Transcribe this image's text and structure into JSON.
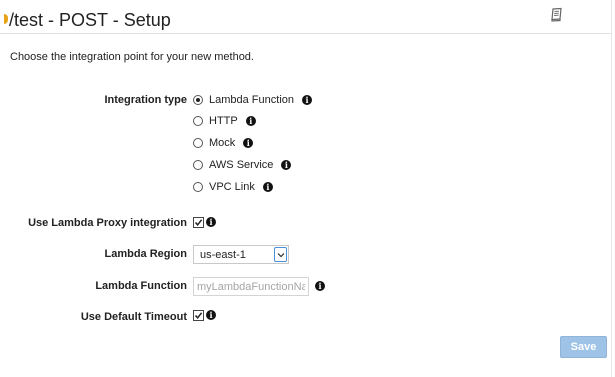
{
  "header": {
    "title": "/test - POST - Setup",
    "help_icon": "book-icon"
  },
  "intro": "Choose the integration point for your new method.",
  "integration_type": {
    "label": "Integration type",
    "selected": "Lambda Function",
    "options": [
      {
        "label": "Lambda Function",
        "checked": true
      },
      {
        "label": "HTTP",
        "checked": false
      },
      {
        "label": "Mock",
        "checked": false
      },
      {
        "label": "AWS Service",
        "checked": false
      },
      {
        "label": "VPC Link",
        "checked": false
      }
    ]
  },
  "proxy_integration": {
    "label": "Use Lambda Proxy integration",
    "checked": true
  },
  "lambda_region": {
    "label": "Lambda Region",
    "value": "us-east-1"
  },
  "lambda_function": {
    "label": "Lambda Function",
    "value": "",
    "placeholder": "myLambdaFunctionName"
  },
  "default_timeout": {
    "label": "Use Default Timeout",
    "checked": true
  },
  "actions": {
    "save_label": "Save"
  },
  "icons": {
    "info": "info-icon",
    "dropdown": "chevron-down-icon"
  },
  "colors": {
    "accent": "#e8a317",
    "save_button": "#9ec3e6",
    "select_focus": "#4a90d9"
  }
}
